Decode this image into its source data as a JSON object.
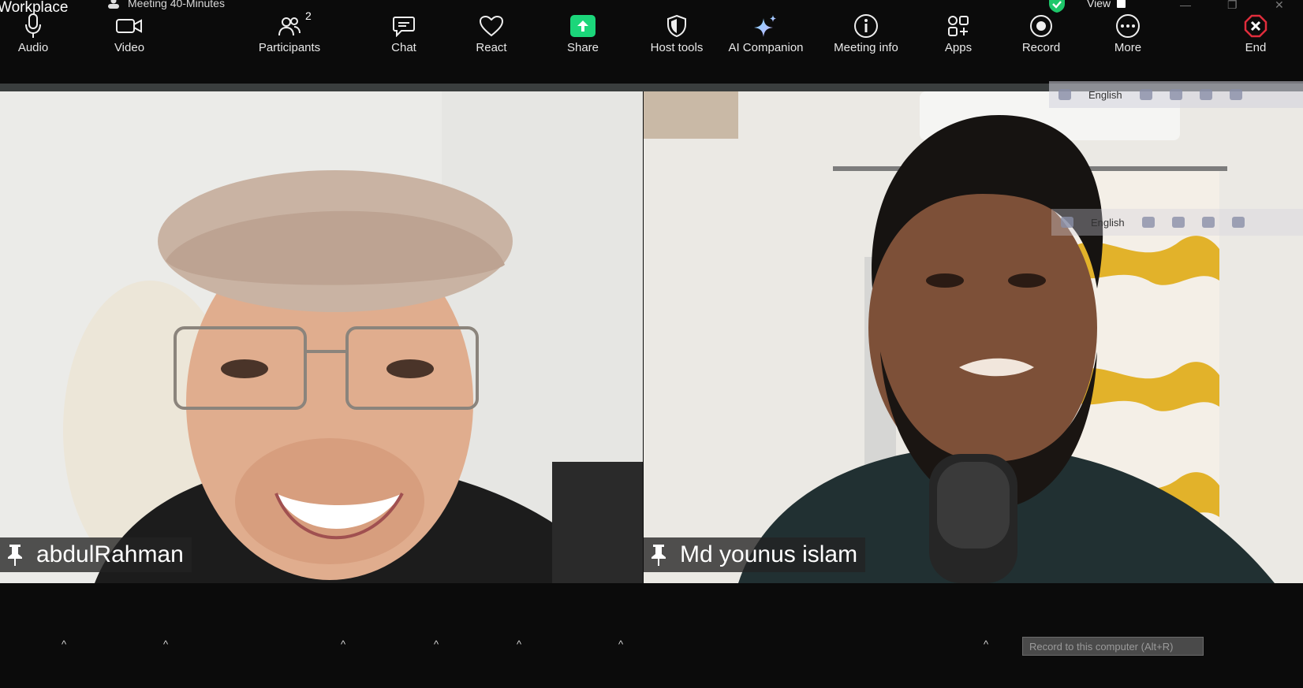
{
  "titlebar": {
    "app_title": "Workplace",
    "meeting_title": "Meeting 40-Minutes",
    "view_label": "View"
  },
  "ime": {
    "language": "English"
  },
  "participants": [
    {
      "name": "abdulRahman"
    },
    {
      "name": "Md younus islam"
    }
  ],
  "toolbar": {
    "audio_label": "Audio",
    "video_label": "Video",
    "participants_label": "Participants",
    "participants_count": "2",
    "chat_label": "Chat",
    "react_label": "React",
    "share_label": "Share",
    "host_tools_label": "Host tools",
    "ai_companion_label": "AI Companion",
    "meeting_info_label": "Meeting info",
    "apps_label": "Apps",
    "record_label": "Record",
    "more_label": "More",
    "end_label": "End",
    "record_hint": "Record to this computer (Alt+R)"
  },
  "colors": {
    "background": "#0b0b0b",
    "share_green": "#1bd67a",
    "end_red": "#e02d3c",
    "shield_green": "#1ec76a"
  }
}
